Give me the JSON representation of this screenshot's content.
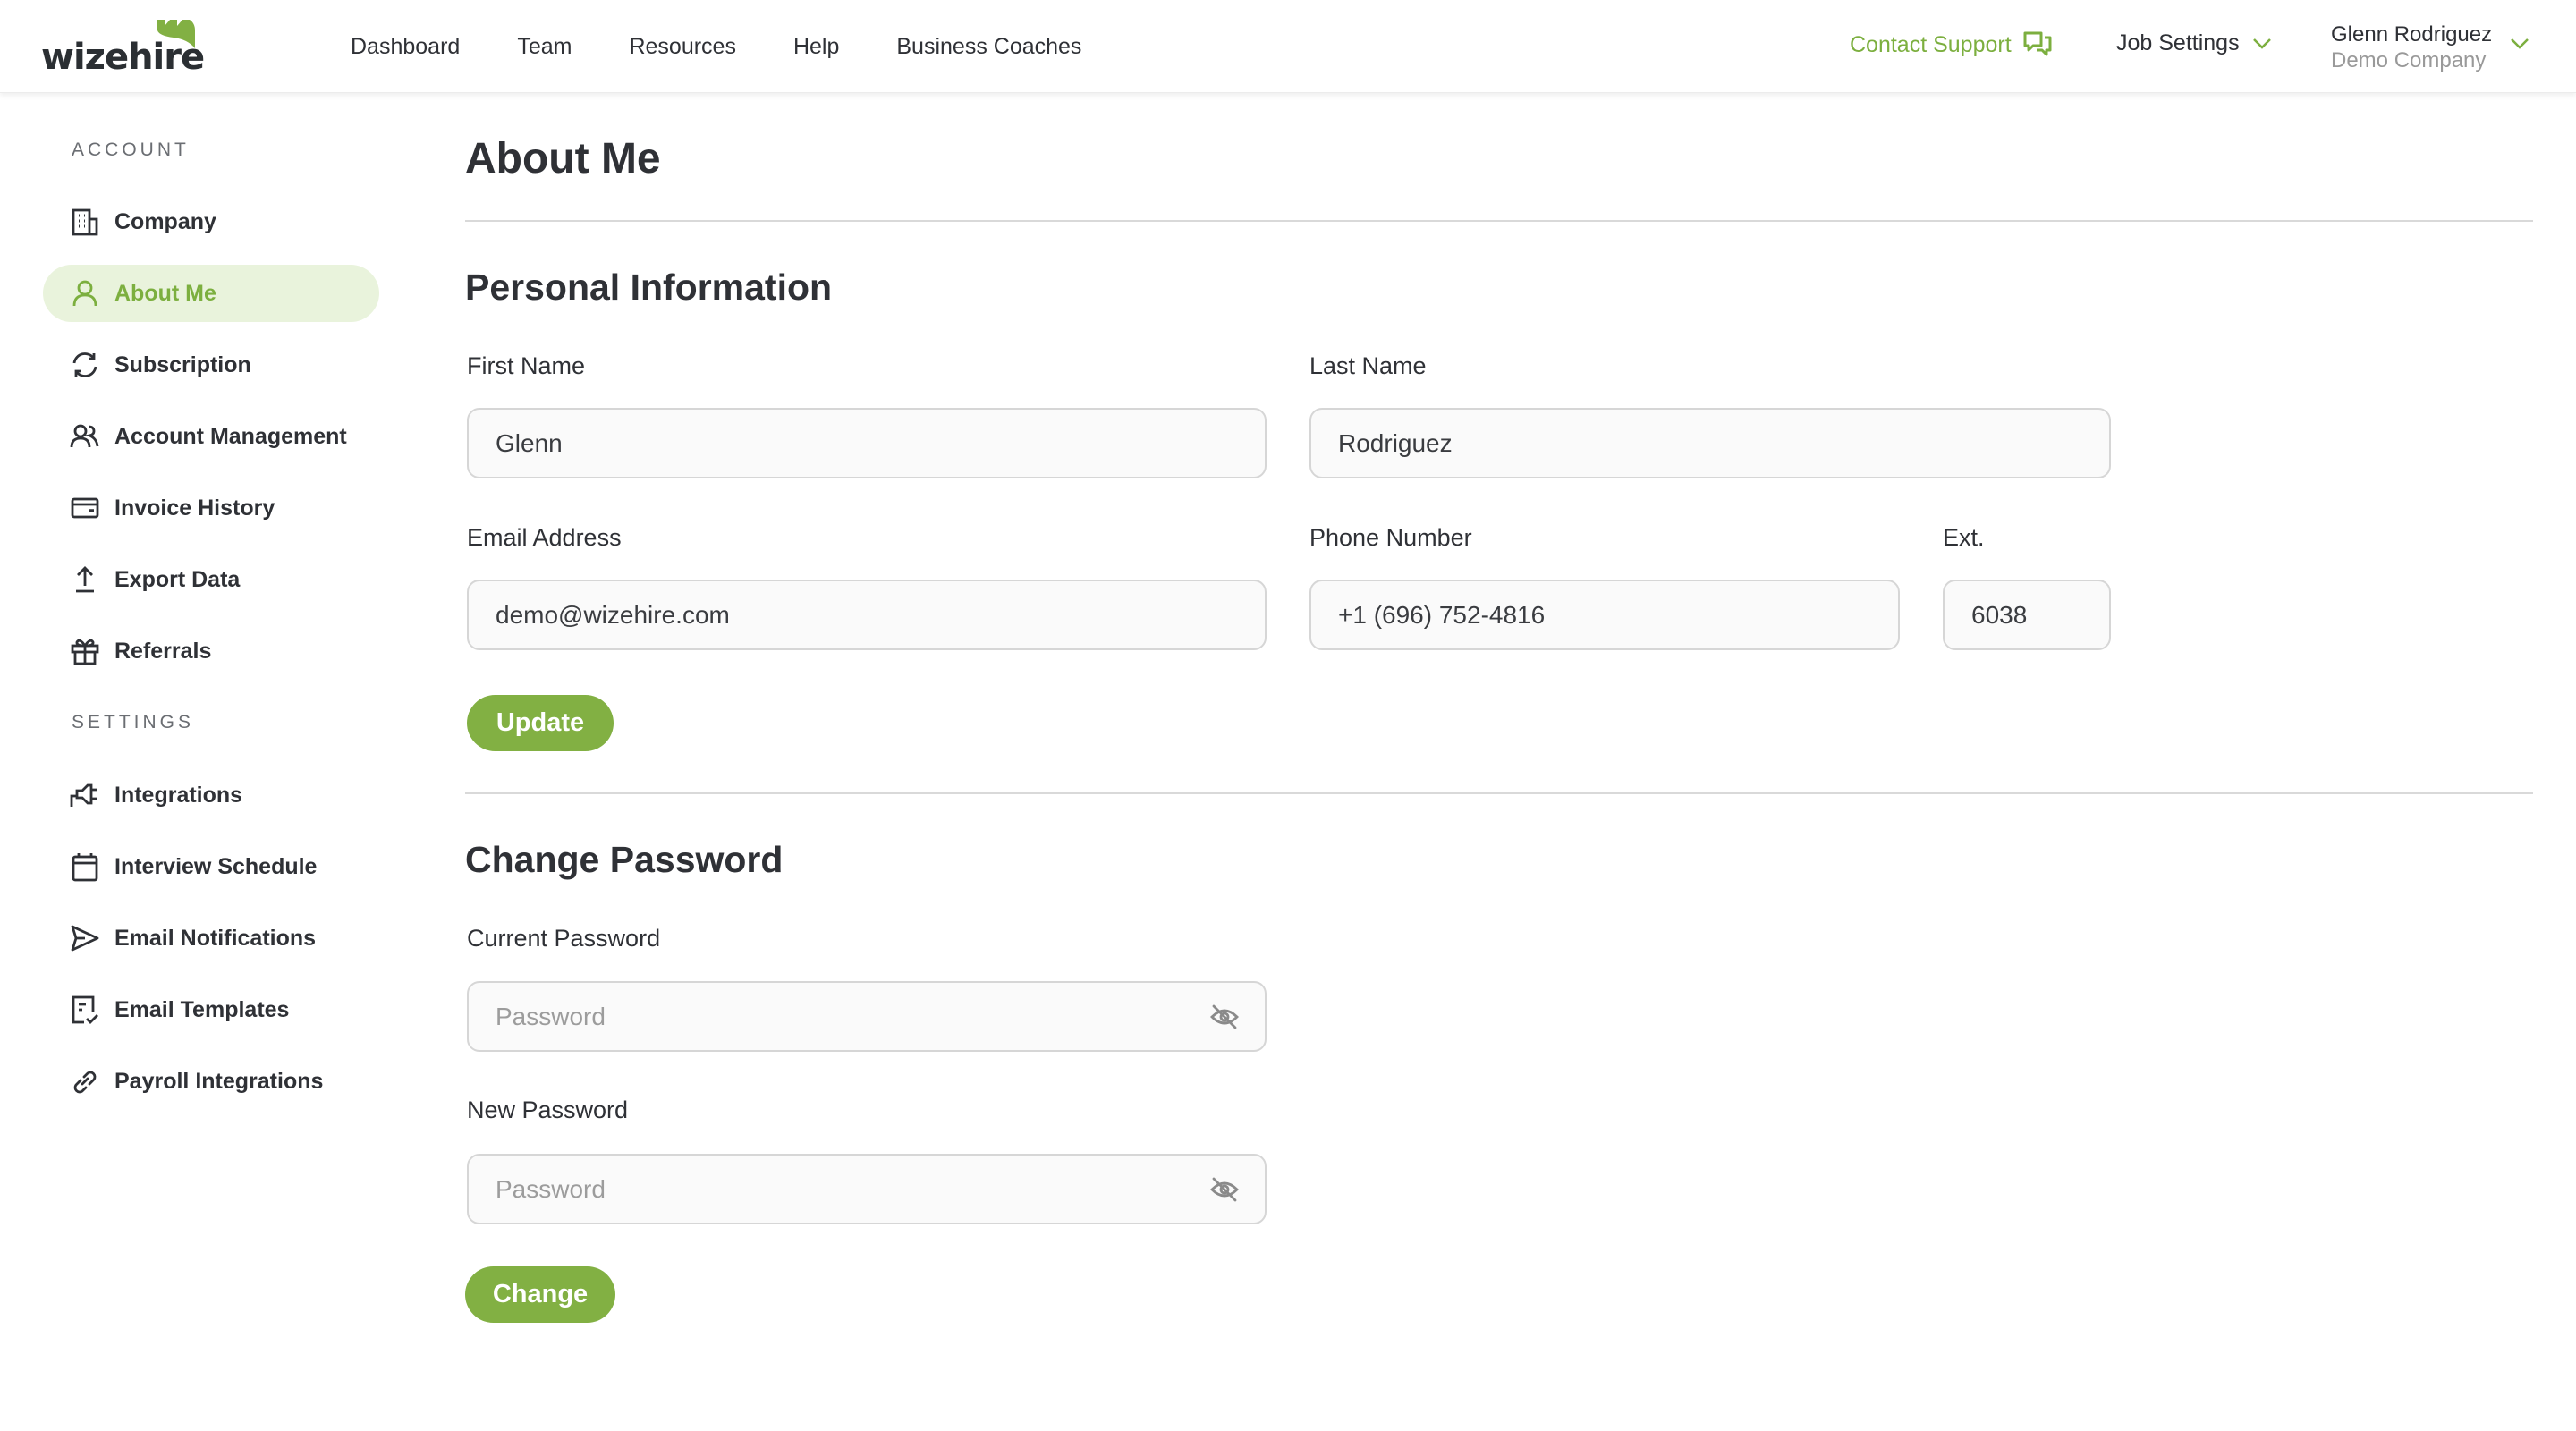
{
  "brand": {
    "name": "wizehire",
    "accent": "#82b043",
    "accent_text": "#7caf3f",
    "active_bg": "#e9f3dc"
  },
  "header": {
    "nav": [
      {
        "label": "Dashboard"
      },
      {
        "label": "Team"
      },
      {
        "label": "Resources"
      },
      {
        "label": "Help"
      },
      {
        "label": "Business Coaches"
      }
    ],
    "contact_support": {
      "label": "Contact Support",
      "icon": "chat-bubbles-icon"
    },
    "job_settings": {
      "label": "Job Settings",
      "icon": "chevron-down-icon"
    },
    "user": {
      "name": "Glenn Rodriguez",
      "company": "Demo Company",
      "icon": "chevron-down-icon"
    }
  },
  "sidebar": {
    "account_heading": "ACCOUNT",
    "account_items": [
      {
        "label": "Company",
        "icon": "building-icon",
        "active": false
      },
      {
        "label": "About Me",
        "icon": "user-icon",
        "active": true
      },
      {
        "label": "Subscription",
        "icon": "refresh-icon",
        "active": false
      },
      {
        "label": "Account Management",
        "icon": "users-icon",
        "active": false
      },
      {
        "label": "Invoice History",
        "icon": "wallet-icon",
        "active": false
      },
      {
        "label": "Export Data",
        "icon": "upload-icon",
        "active": false
      },
      {
        "label": "Referrals",
        "icon": "gift-icon",
        "active": false
      }
    ],
    "settings_heading": "SETTINGS",
    "settings_items": [
      {
        "label": "Integrations",
        "icon": "plug-icon"
      },
      {
        "label": "Interview Schedule",
        "icon": "calendar-icon"
      },
      {
        "label": "Email Notifications",
        "icon": "send-icon"
      },
      {
        "label": "Email Templates",
        "icon": "document-check-icon"
      },
      {
        "label": "Payroll Integrations",
        "icon": "link-icon"
      }
    ]
  },
  "main": {
    "title": "About Me",
    "personal": {
      "heading": "Personal Information",
      "first_name": {
        "label": "First Name",
        "value": "Glenn"
      },
      "last_name": {
        "label": "Last Name",
        "value": "Rodriguez"
      },
      "email": {
        "label": "Email Address",
        "value": "demo@wizehire.com"
      },
      "phone": {
        "label": "Phone Number",
        "value": "+1 (696) 752-4816"
      },
      "ext": {
        "label": "Ext.",
        "value": "6038"
      },
      "submit_label": "Update"
    },
    "password": {
      "heading": "Change Password",
      "current": {
        "label": "Current Password",
        "placeholder": "Password",
        "icon": "eye-off-icon"
      },
      "new": {
        "label": "New Password",
        "placeholder": "Password",
        "icon": "eye-off-icon"
      },
      "submit_label": "Change"
    }
  }
}
